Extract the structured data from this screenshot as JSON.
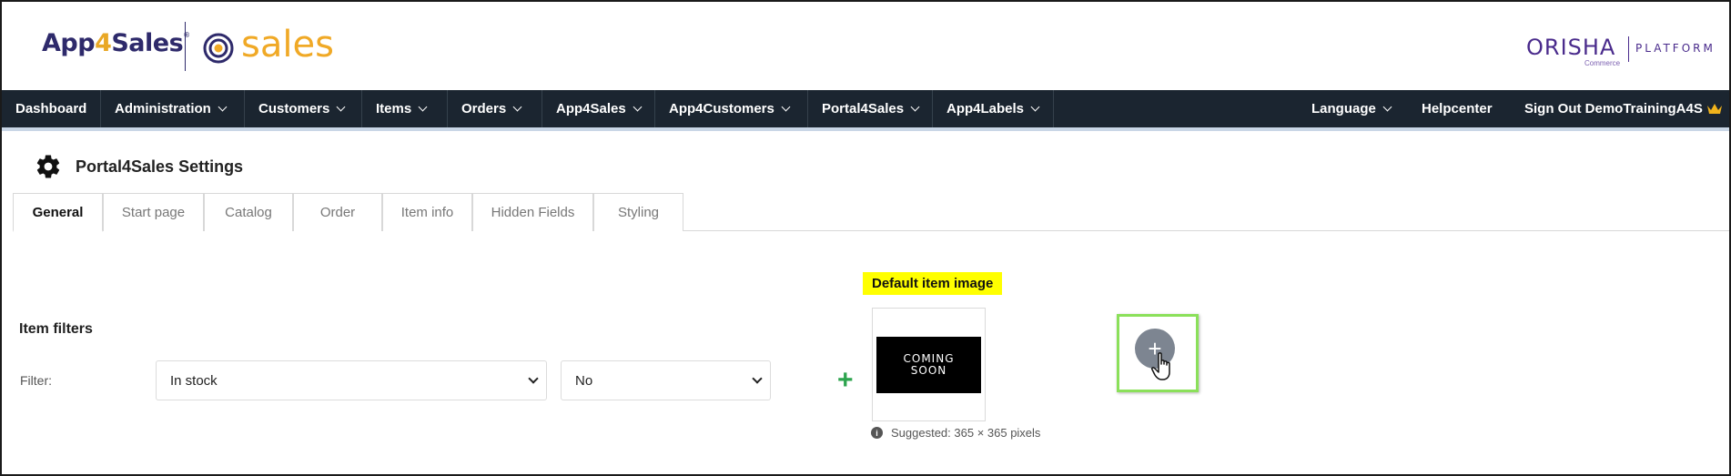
{
  "header": {
    "logo_left": "App4Sales",
    "logo_left_part1": "App",
    "logo_left_part2": "4",
    "logo_left_part3": "Sales",
    "logo_left_reg": "®",
    "logo_sales": "sales",
    "orisha_word": "ORISHA",
    "orisha_sub": "Commerce",
    "orisha_platform": "PLATFORM"
  },
  "nav": {
    "items": [
      {
        "label": "Dashboard",
        "dropdown": false
      },
      {
        "label": "Administration",
        "dropdown": true
      },
      {
        "label": "Customers",
        "dropdown": true
      },
      {
        "label": "Items",
        "dropdown": true
      },
      {
        "label": "Orders",
        "dropdown": true
      },
      {
        "label": "App4Sales",
        "dropdown": true
      },
      {
        "label": "App4Customers",
        "dropdown": true
      },
      {
        "label": "Portal4Sales",
        "dropdown": true
      },
      {
        "label": "App4Labels",
        "dropdown": true
      }
    ],
    "right": {
      "language": "Language",
      "helpcenter": "Helpcenter",
      "signout": "Sign Out DemoTrainingA4S"
    }
  },
  "page": {
    "title": "Portal4Sales Settings",
    "icon": "gear-icon"
  },
  "tabs": [
    {
      "label": "General",
      "active": true
    },
    {
      "label": "Start page",
      "active": false
    },
    {
      "label": "Catalog",
      "active": false
    },
    {
      "label": "Order",
      "active": false
    },
    {
      "label": "Item info",
      "active": false
    },
    {
      "label": "Hidden Fields",
      "active": false
    },
    {
      "label": "Styling",
      "active": false
    }
  ],
  "item_filters": {
    "title": "Item filters",
    "filter_label": "Filter:",
    "filter_select_value": "In stock",
    "value_select_value": "No"
  },
  "default_image": {
    "label": "Default item image",
    "placeholder_line1": "COMING",
    "placeholder_line2": "SOON",
    "suggested": "Suggested: 365 × 365 pixels"
  },
  "colors": {
    "nav_bg": "#1b2530",
    "highlight": "#ffff00",
    "add_green": "#2da44e",
    "upload_border": "#8be05a",
    "brand_orange": "#f0a926",
    "brand_navy": "#2e2a6b"
  }
}
